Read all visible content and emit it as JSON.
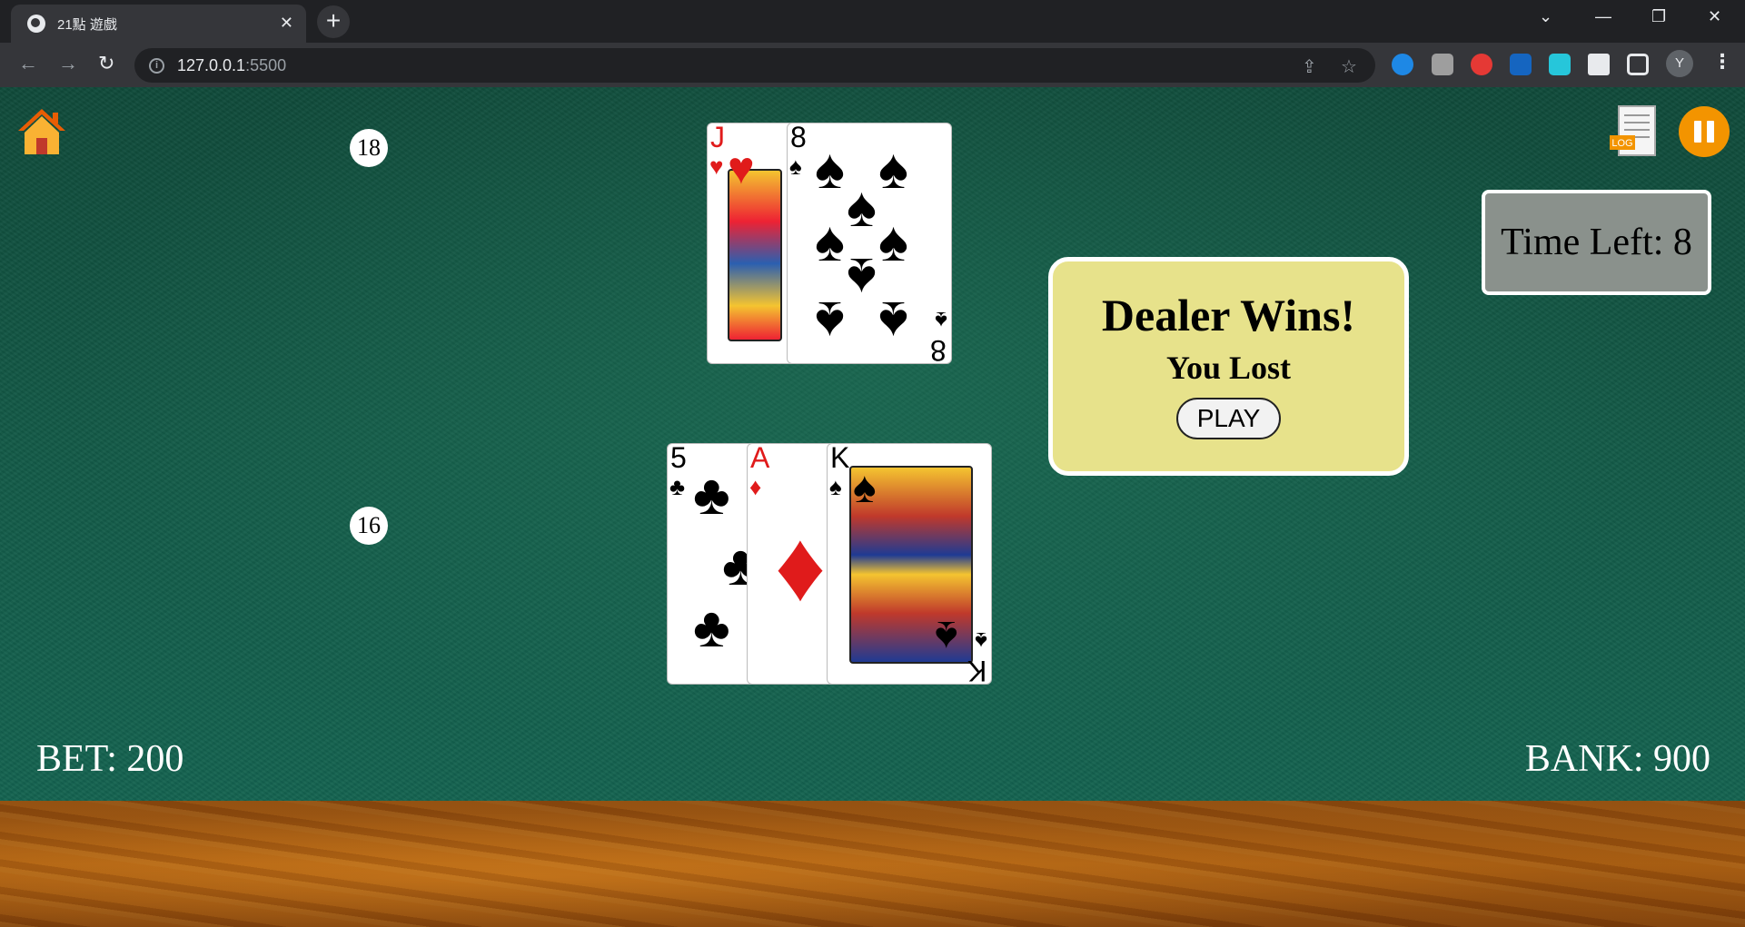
{
  "browser": {
    "tab_title": "21點 遊戲",
    "url_host": "127.0.0.1",
    "url_port": ":5500",
    "profile_initial": "Y"
  },
  "game": {
    "dealer_score": "18",
    "player_score": "16",
    "dealer_cards": [
      {
        "rank": "J",
        "suit": "♥",
        "color": "#e01b1b"
      },
      {
        "rank": "8",
        "suit": "♠",
        "color": "#000000"
      }
    ],
    "player_cards": [
      {
        "rank": "5",
        "suit": "♣",
        "color": "#000000"
      },
      {
        "rank": "A",
        "suit": "♦",
        "color": "#e01b1b"
      },
      {
        "rank": "K",
        "suit": "♠",
        "color": "#000000"
      }
    ],
    "timer_text": "Time Left: 8",
    "result_title": "Dealer Wins!",
    "result_subtitle": "You Lost",
    "play_label": "PLAY",
    "bet_text": "BET: 200",
    "bank_text": "BANK: 900",
    "log_label": "LOG"
  },
  "colors": {
    "felt": "#135a47",
    "result_bg": "#e7e28b",
    "pause_bg": "#f39400",
    "timer_bg": "#8a918c"
  }
}
